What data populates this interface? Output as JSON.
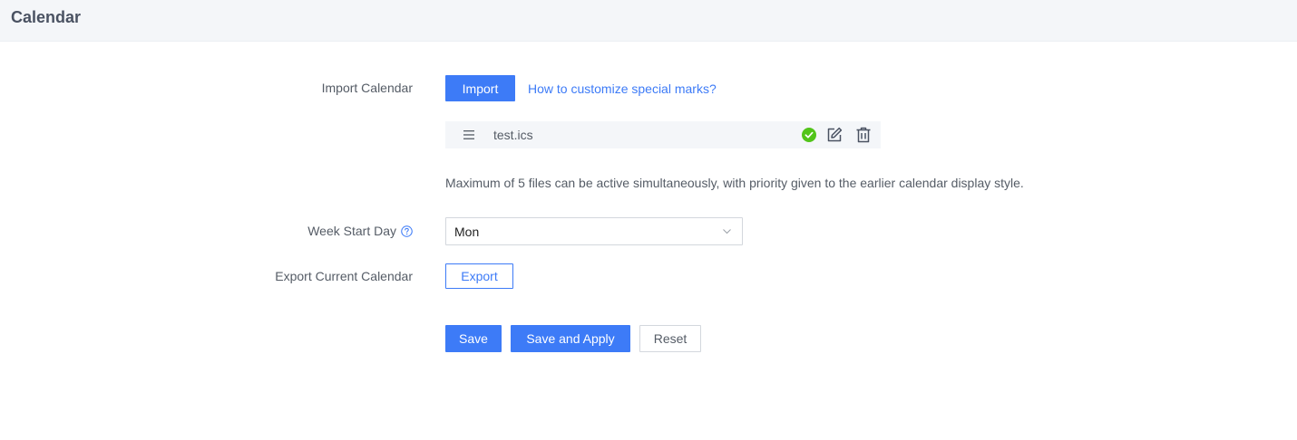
{
  "header": {
    "title": "Calendar"
  },
  "import_section": {
    "label": "Import Calendar",
    "import_button": "Import",
    "help_link": "How to customize special marks?",
    "files": [
      {
        "name": "test.ics",
        "status": "active",
        "status_color": "#52c41a"
      }
    ],
    "hint": "Maximum of 5 files can be active simultaneously, with priority given to the earlier calendar display style."
  },
  "week_start": {
    "label": "Week Start Day",
    "selected": "Mon",
    "help_icon": "question-circle-icon"
  },
  "export_section": {
    "label": "Export Current Calendar",
    "export_button": "Export"
  },
  "actions": {
    "save": "Save",
    "save_apply": "Save and Apply",
    "reset": "Reset"
  },
  "colors": {
    "primary": "#3d7bf7",
    "header_bg": "#f4f6f9",
    "text": "#555c66"
  }
}
